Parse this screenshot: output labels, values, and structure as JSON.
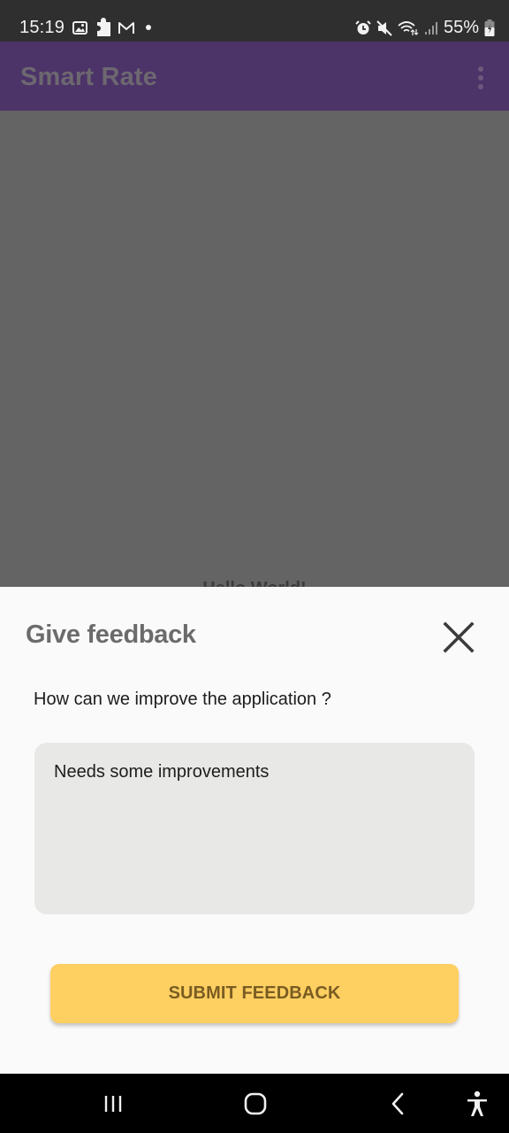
{
  "status_bar": {
    "time": "15:19",
    "left_icons": [
      "gallery-icon",
      "puzzle-icon",
      "gmail-icon",
      "dot-icon"
    ],
    "right_icons": [
      "alarm-icon",
      "mute-icon",
      "wifi-icon",
      "signal-icon"
    ],
    "battery_percent": "55%"
  },
  "app_bar": {
    "title": "Smart Rate",
    "menu_icon": "overflow-menu-icon"
  },
  "background_content": {
    "text": "Hello World!"
  },
  "feedback_sheet": {
    "title": "Give feedback",
    "close_icon": "close-icon",
    "question": "How can we improve the application ?",
    "input_value": "Needs some improvements",
    "submit_label": "SUBMIT FEEDBACK",
    "colors": {
      "submit_bg": "#fecf61",
      "submit_text": "#7a5d22",
      "input_bg": "#e8e8e6",
      "app_bar_bg": "#4c3368"
    }
  },
  "nav_bar": {
    "buttons": [
      "recents-icon",
      "home-icon",
      "back-icon",
      "accessibility-icon"
    ]
  }
}
